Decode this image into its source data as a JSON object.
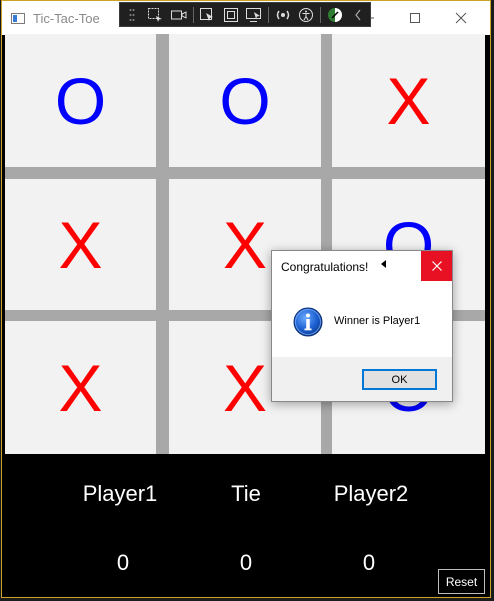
{
  "window": {
    "title": "Tic-Tac-Toe",
    "icons": [
      "app-icon",
      "minimize-icon",
      "maximize-icon",
      "close-icon"
    ]
  },
  "toolbar": {
    "icons": [
      "select-element-icon",
      "video-icon",
      "pointer-icon",
      "frame-icon",
      "screen-select-icon",
      "broadcast-icon",
      "accessibility-icon",
      "theme-icon",
      "collapse-icon"
    ]
  },
  "board": {
    "cells": [
      "O",
      "O",
      "X",
      "X",
      "X",
      "O",
      "X",
      "X",
      "O"
    ],
    "colors": {
      "O": "#0000ff",
      "X": "#ff0000"
    }
  },
  "dialog": {
    "title": "Congratulations!",
    "message": "Winner is Player1",
    "ok_label": "OK",
    "icons": [
      "info-icon",
      "close-icon"
    ]
  },
  "scoreboard": {
    "player1_label": "Player1",
    "tie_label": "Tie",
    "player2_label": "Player2",
    "player1_score": "0",
    "tie_score": "0",
    "player2_score": "0",
    "reset_label": "Reset"
  }
}
